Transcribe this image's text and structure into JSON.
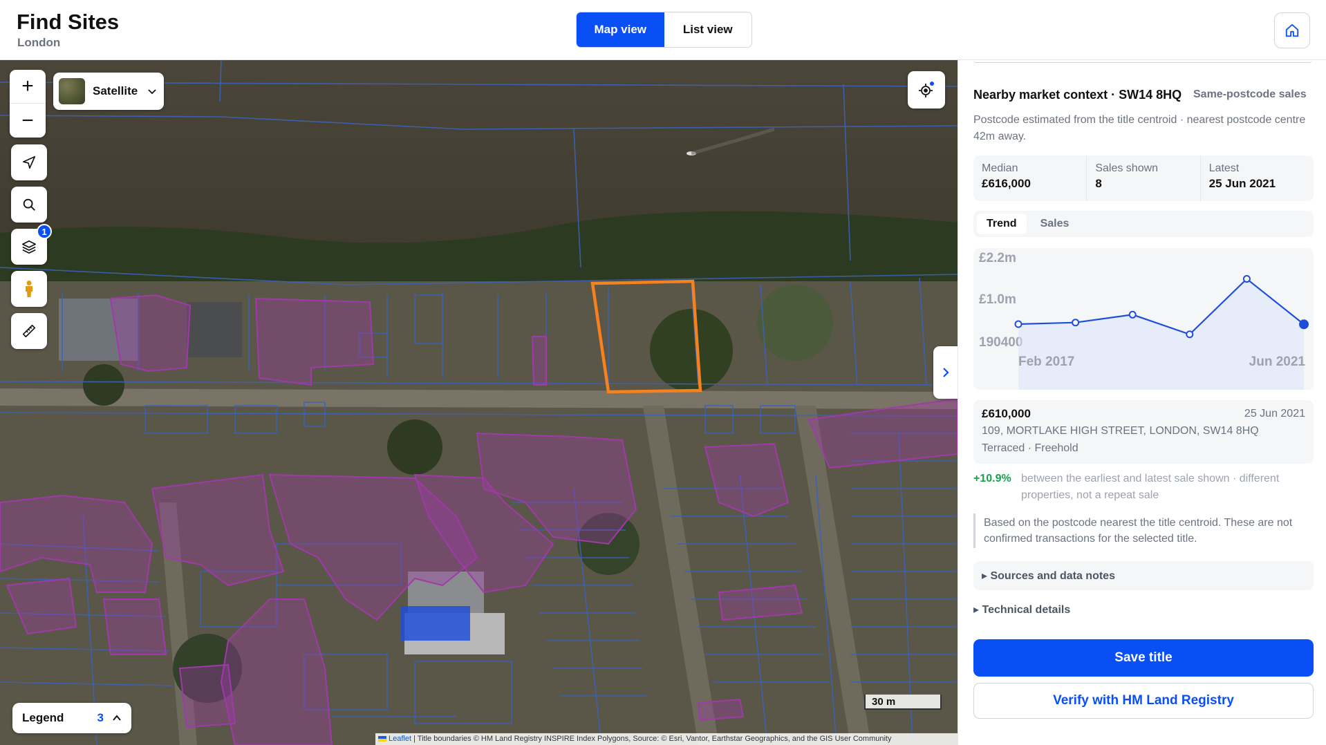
{
  "header": {
    "title": "Find Sites",
    "subtitle": "London",
    "views": [
      {
        "label": "Map view",
        "active": true
      },
      {
        "label": "List view",
        "active": false
      }
    ],
    "home_icon": "home-icon"
  },
  "map": {
    "basemap_label": "Satellite",
    "zoom_in": "+",
    "zoom_out": "−",
    "layers_badge": "1",
    "tools": [
      "navigate-icon",
      "search-icon",
      "layers-icon",
      "pegman-icon",
      "ruler-icon"
    ],
    "legend_label": "Legend",
    "legend_count": "3",
    "scale_label": "30 m",
    "attribution_link": "Leaflet",
    "attribution_text": " | Title boundaries © HM Land Registry INSPIRE Index Polygons, Source: © Esri, Vantor, Earthstar Geographics, and the GIS User Community",
    "colors": {
      "selected_parcel": "#f6821f",
      "boundary": "#3a63b8",
      "highlight": "#a03aa8"
    }
  },
  "panel": {
    "context_title": "Nearby market context · SW14 8HQ",
    "context_tag": "Same-postcode sales",
    "context_note": "Postcode estimated from the title centroid · nearest postcode centre 42m away.",
    "stats": [
      {
        "label": "Median",
        "value": "£616,000"
      },
      {
        "label": "Sales shown",
        "value": "8"
      },
      {
        "label": "Latest",
        "value": "25 Jun 2021"
      }
    ],
    "tabs": [
      {
        "label": "Trend",
        "active": true
      },
      {
        "label": "Sales",
        "active": false
      }
    ],
    "sale": {
      "price": "£610,000",
      "date": "25 Jun 2021",
      "address": "109, MORTLAKE HIGH STREET, LONDON, SW14 8HQ",
      "type": "Terraced · Freehold"
    },
    "change_pct": "+10.9%",
    "change_text": "between the earliest and latest sale shown · different properties, not a repeat sale",
    "note": "Based on the postcode nearest the title centroid. These are not confirmed transactions for the selected title.",
    "sources_label": "▸ Sources and data notes",
    "tech_label": "▸ Technical details",
    "save_label": "Save title",
    "verify_label": "Verify with HM Land Registry"
  },
  "chart_data": {
    "type": "line",
    "y_tick_labels": [
      "£2.2m",
      "£1.0m",
      "190400"
    ],
    "x_tick_labels": [
      "Feb 2017",
      "Jun 2021"
    ],
    "ylim": [
      190400,
      2200000
    ],
    "series": [
      {
        "values": [
          616000,
          660000,
          880000,
          330000,
          1880000,
          610000
        ]
      }
    ],
    "color": "#1d4ed8"
  }
}
